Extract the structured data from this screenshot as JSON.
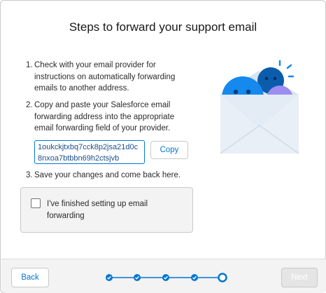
{
  "dialog": {
    "title": "Steps to forward your support email"
  },
  "steps": [
    {
      "number": "1.",
      "text": "Check with your email provider for instructions on automatically forwarding emails to another address."
    },
    {
      "number": "2.",
      "text": "Copy and paste your Salesforce email forwarding address into the appropriate email forwarding field of your provider."
    },
    {
      "number": "3.",
      "text": "Save your changes and come back here."
    }
  ],
  "forwarding": {
    "address": "1oukckjtxbq7cck8p2jsa21d0c8nxoa7btbbn69h2ctsjvb",
    "copy_label": "Copy"
  },
  "confirmation": {
    "checked": false,
    "label": "I've finished setting up email forwarding"
  },
  "footer": {
    "back_label": "Back",
    "next_label": "Next",
    "progress": {
      "total_steps": 5,
      "completed_steps": 4,
      "current_step": 5
    }
  },
  "colors": {
    "accent": "#0176d3",
    "illustration_blue": "#1589ee",
    "illustration_dark_blue": "#0b5cab",
    "illustration_purple": "#9d8df0",
    "envelope": "#e3ecf5",
    "disabled": "#e5e5e5"
  }
}
